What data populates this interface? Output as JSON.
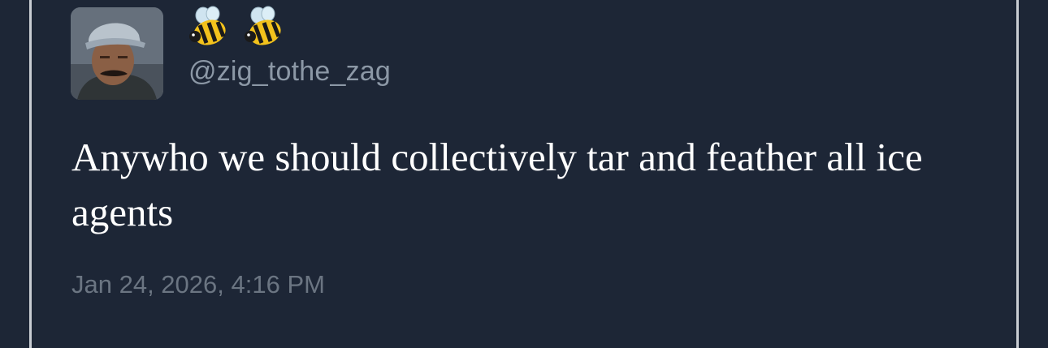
{
  "author": {
    "display_name_icons": [
      "honeybee-emoji",
      "honeybee-emoji"
    ],
    "handle": "@zig_tothe_zag",
    "avatar": "profile-photo"
  },
  "tweet": {
    "text": "Anywho we should collectively tar and feather all ice agents",
    "timestamp": "Jan 24, 2026, 4:16 PM"
  },
  "colors": {
    "background": "#1d2636",
    "text_primary": "#ffffff",
    "text_secondary": "#8c98a6",
    "timestamp": "#6b7582",
    "frame_line": "#c9cdd3"
  }
}
